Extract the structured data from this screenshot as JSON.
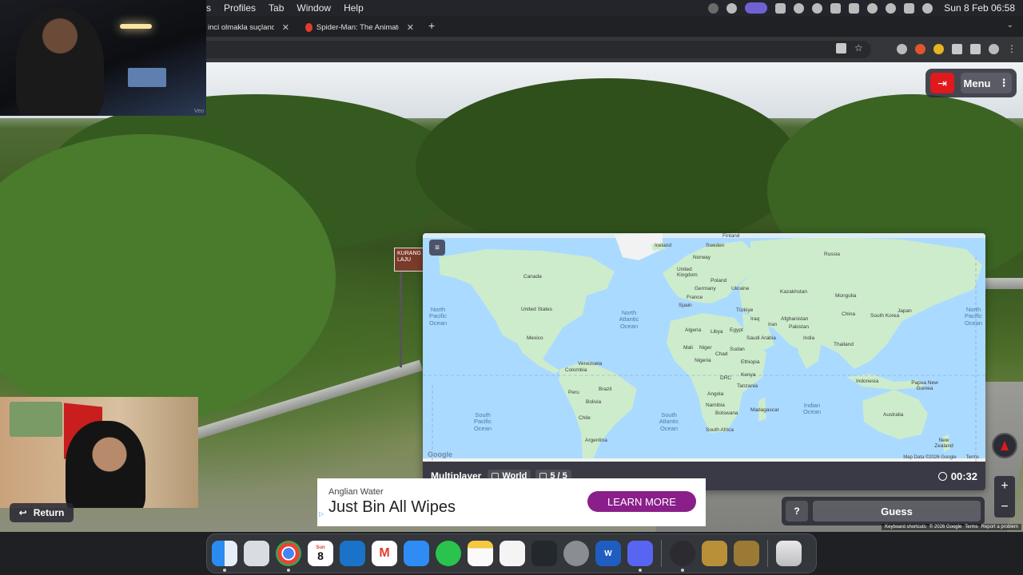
{
  "menubar": {
    "items": [
      "s",
      "Profiles",
      "Tab",
      "Window",
      "Help"
    ],
    "clock": "Sun 8 Feb  06:58"
  },
  "browser": {
    "tabs": [
      {
        "title": "inci olmakla suçlandım"
      },
      {
        "title": "Spider-Man: The Animated Se"
      }
    ],
    "new_tab": "+"
  },
  "game": {
    "menu_label": "Menu",
    "mode": "Multiplayer",
    "map_name": "World",
    "round": "5 / 5",
    "timer": "00:32",
    "guess_label": "Guess",
    "help_label": "?",
    "return_label": "Return",
    "road_sign": "KURANG LAJU"
  },
  "map": {
    "countries": [
      "Finland",
      "Sweden",
      "Iceland",
      "Norway",
      "Russia",
      "United Kingdom",
      "Poland",
      "Germany",
      "Ukraine",
      "France",
      "Kazakhstan",
      "Mongolia",
      "Spain",
      "Türkiye",
      "Canada",
      "United States",
      "Mexico",
      "Algeria",
      "Libya",
      "Egypt",
      "Iraq",
      "Iran",
      "Afghanistan",
      "Pakistan",
      "China",
      "South Korea",
      "Japan",
      "Saudi Arabia",
      "India",
      "Mali",
      "Niger",
      "Chad",
      "Sudan",
      "Thailand",
      "Nigeria",
      "Ethiopia",
      "Venezuela",
      "Colombia",
      "DRC",
      "Kenya",
      "Indonesia",
      "Papua New Guinea",
      "Peru",
      "Brazil",
      "Tanzania",
      "Angola",
      "Bolivia",
      "Namibia",
      "Botswana",
      "Madagascar",
      "Australia",
      "Chile",
      "Argentina",
      "South Africa",
      "New Zealand"
    ],
    "oceans": [
      "North Pacific Ocean",
      "North Atlantic Ocean",
      "North Pacific Ocean",
      "South Pacific Ocean",
      "South Atlantic Ocean",
      "Indian Ocean"
    ],
    "google": "Google",
    "credit_data": "Map Data ©2026 Google",
    "credit_terms": "Terms"
  },
  "streetview_footer": [
    "Keyboard shortcuts",
    "© 2026 Google",
    "Terms",
    "Report a problem"
  ],
  "ad": {
    "brand": "Anglian Water",
    "headline": "Just Bin All Wipes",
    "cta": "LEARN MORE"
  },
  "webcam1_watermark": "Veo",
  "dock": {
    "calendar_day": "8",
    "calendar_month": "Sun",
    "apps": [
      "finder-icon",
      "launchpad-icon",
      "chrome-icon",
      "calendar-icon",
      "outlook-icon",
      "gmail-icon",
      "mail-icon",
      "whatsapp-icon",
      "notes-icon",
      "reminders-icon",
      "numbers-icon",
      "system-settings-icon",
      "word-icon",
      "discord-icon",
      "obs-icon",
      "league-icon",
      "league-icon-2",
      "trash-icon"
    ]
  },
  "colors": {
    "exit_red": "#e0191c",
    "ad_cta": "#8a1f8a",
    "map_water": "#aadaff",
    "map_land": "#cdeccc"
  }
}
